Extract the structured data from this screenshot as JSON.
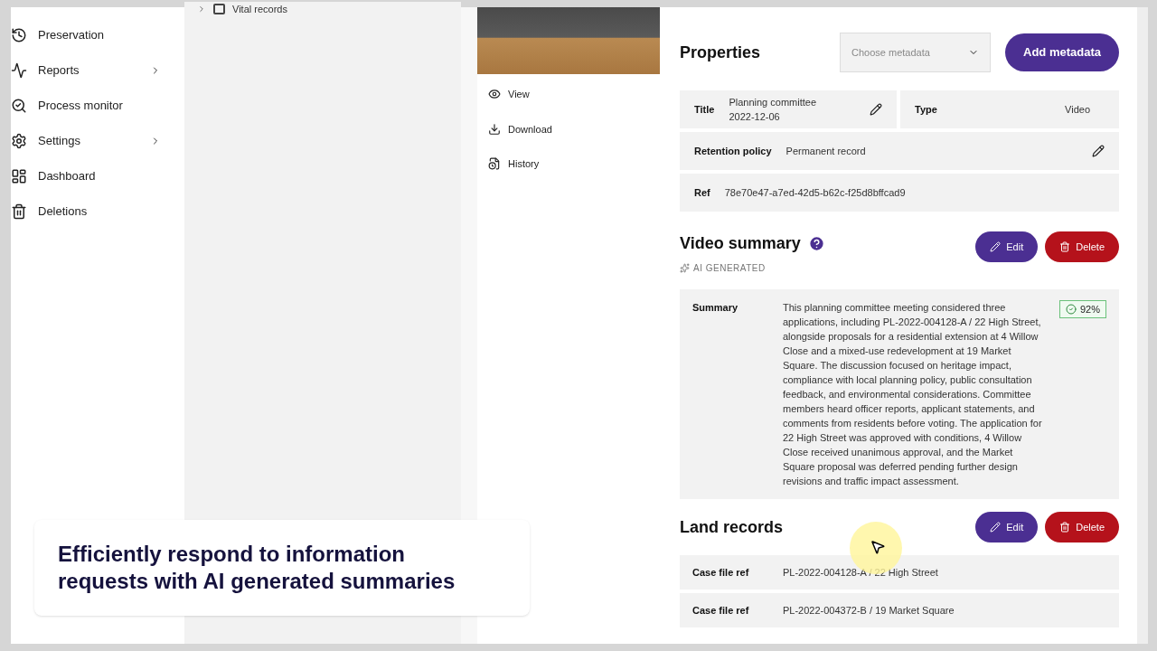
{
  "sidebar": {
    "items": [
      {
        "label": "Preservation",
        "has_submenu": false
      },
      {
        "label": "Reports",
        "has_submenu": true
      },
      {
        "label": "Process monitor",
        "has_submenu": false
      },
      {
        "label": "Settings",
        "has_submenu": true
      },
      {
        "label": "Dashboard",
        "has_submenu": false
      },
      {
        "label": "Deletions",
        "has_submenu": false
      }
    ]
  },
  "tree": {
    "items": [
      {
        "label": "Vital records",
        "expanded": false,
        "checked": false
      }
    ]
  },
  "file_actions": [
    "View",
    "Download",
    "History"
  ],
  "properties": {
    "heading": "Properties",
    "metadata_select": {
      "placeholder": "Choose metadata"
    },
    "add_button": "Add metadata",
    "rows": [
      [
        {
          "label": "Title",
          "value": "Planning committee 2022-12-06",
          "editable": true
        },
        {
          "label": "Type",
          "value": "Video",
          "editable": false
        }
      ],
      [
        {
          "label": "Retention policy",
          "value": "Permanent record",
          "editable": true
        }
      ],
      [
        {
          "label": "Ref",
          "value": "78e70e47-a7ed-42d5-b62c-f25d8bffcad9",
          "editable": false
        }
      ]
    ]
  },
  "video_summary": {
    "heading": "Video summary",
    "badge": "AI GENERATED",
    "edit": "Edit",
    "delete": "Delete",
    "label": "Summary",
    "confidence": "92%",
    "text": "This planning committee meeting considered three applications, including PL-2022-004128-A / 22 High Street, alongside proposals for a residential extension at 4 Willow Close and a mixed-use redevelopment at 19 Market Square. The discussion focused on heritage impact, compliance with local planning policy, public consultation feedback, and environmental considerations. Committee members heard officer reports, applicant statements, and comments from residents before voting. The application for 22 High Street was approved with conditions, 4 Willow Close received unanimous approval, and the Market Square proposal was deferred pending further design revisions and traffic impact assessment."
  },
  "land_records": {
    "heading": "Land records",
    "edit": "Edit",
    "delete": "Delete",
    "rows": [
      {
        "label": "Case file ref",
        "value": "PL-2022-004128-A / 22 High Street"
      },
      {
        "label": "Case file ref",
        "value": "PL-2022-004372-B / 19 Market Square"
      }
    ]
  },
  "caption": "Efficiently respond to information requests with AI generated summaries"
}
